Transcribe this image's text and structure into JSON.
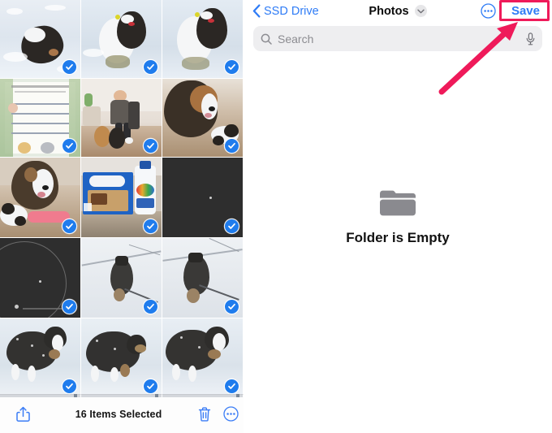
{
  "accent": {
    "ios_blue": "#2f7cf6",
    "badge_blue": "#1f7ced",
    "annotation_pink": "#ef1a5a",
    "folder_gray": "#8c8c91",
    "search_bg": "#eeeef0"
  },
  "photo_picker": {
    "bottom_bar": {
      "share_icon": "share-icon",
      "selection_count": "16 Items Selected",
      "trash_icon": "trash-icon",
      "more_icon": "more-options-icon"
    },
    "grid": {
      "columns": 3,
      "rows": 5,
      "selected_count": 16,
      "cells": [
        {
          "id": "cell-1",
          "scene": "snow-dog-lying",
          "selected": true,
          "has_scrollbar": false
        },
        {
          "id": "cell-2",
          "scene": "snow-dog-on-snowman",
          "selected": true,
          "has_scrollbar": false
        },
        {
          "id": "cell-3",
          "scene": "snow-dog-on-snowman-2",
          "selected": true,
          "has_scrollbar": false
        },
        {
          "id": "cell-4",
          "scene": "baby-shower-invite",
          "selected": true,
          "has_scrollbar": false
        },
        {
          "id": "cell-5",
          "scene": "woman-with-dogs",
          "selected": true,
          "has_scrollbar": false
        },
        {
          "id": "cell-6",
          "scene": "dog-with-plush-toy",
          "selected": true,
          "has_scrollbar": false
        },
        {
          "id": "cell-7",
          "scene": "dog-with-bone-toy",
          "selected": true,
          "has_scrollbar": false
        },
        {
          "id": "cell-8",
          "scene": "poptarts-and-tums",
          "selected": true,
          "has_scrollbar": false
        },
        {
          "id": "cell-9",
          "scene": "dark-video-frame",
          "selected": true,
          "has_scrollbar": false
        },
        {
          "id": "cell-10",
          "scene": "dark-circle-video",
          "selected": true,
          "has_scrollbar": false
        },
        {
          "id": "cell-11",
          "scene": "dog-walking-leash",
          "selected": true,
          "has_scrollbar": false
        },
        {
          "id": "cell-12",
          "scene": "dog-walking-leash-2",
          "selected": true,
          "has_scrollbar": false
        },
        {
          "id": "cell-13",
          "scene": "dog-snowy-coat",
          "selected": true,
          "has_scrollbar": true
        },
        {
          "id": "cell-14",
          "scene": "dog-snowy-coat-2",
          "selected": true,
          "has_scrollbar": true
        },
        {
          "id": "cell-15",
          "scene": "dog-snowy-coat-3",
          "selected": true,
          "has_scrollbar": true
        }
      ]
    }
  },
  "files_panel": {
    "nav": {
      "back_label": "SSD Drive",
      "back_icon": "chevron-left-icon",
      "title": "Photos",
      "title_chevron_icon": "chevron-down-icon",
      "more_icon": "more-options-icon",
      "save_label": "Save"
    },
    "search": {
      "placeholder": "Search",
      "search_icon": "search-icon",
      "mic_icon": "microphone-icon"
    },
    "empty_state": {
      "folder_icon": "folder-icon",
      "title": "Folder is Empty"
    }
  },
  "annotation": {
    "type": "arrow",
    "points_to": "save-button",
    "color": "#ef1a5a",
    "highlight_box_target": "save-button"
  }
}
